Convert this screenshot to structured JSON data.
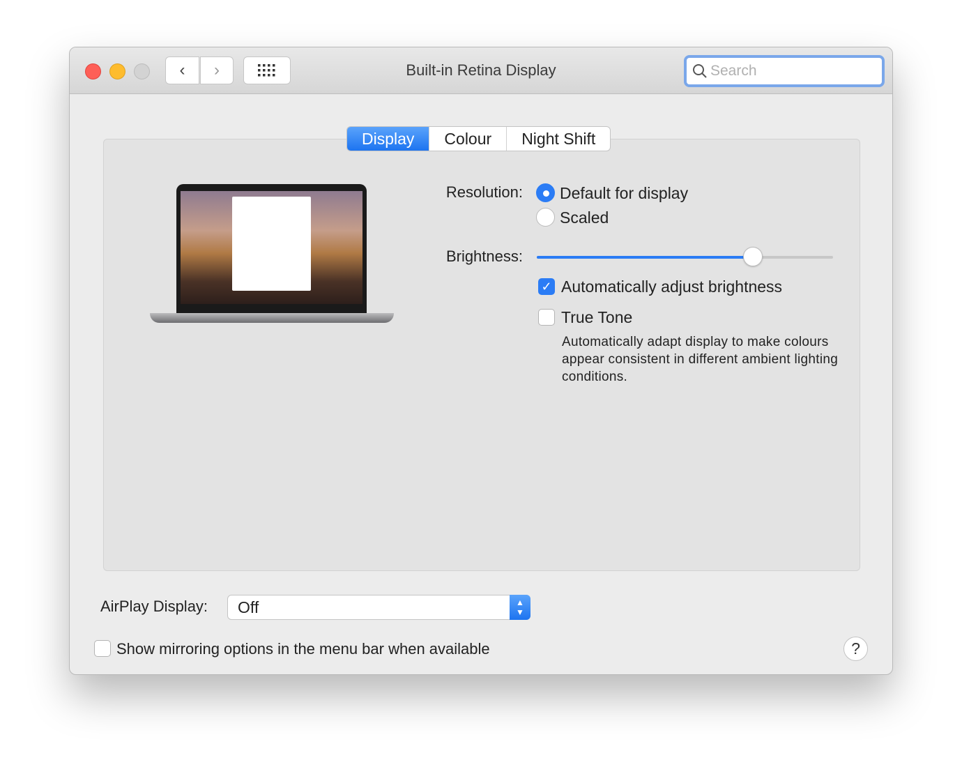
{
  "window": {
    "title": "Built-in Retina Display"
  },
  "toolbar": {
    "back_icon": "chevron-left",
    "forward_icon": "chevron-right",
    "grid_icon": "grid-icon"
  },
  "search": {
    "placeholder": "Search",
    "value": ""
  },
  "tabs": [
    {
      "label": "Display",
      "active": true
    },
    {
      "label": "Colour",
      "active": false
    },
    {
      "label": "Night Shift",
      "active": false
    }
  ],
  "resolution": {
    "label": "Resolution:",
    "options": [
      {
        "label": "Default for display",
        "selected": true
      },
      {
        "label": "Scaled",
        "selected": false
      }
    ]
  },
  "brightness": {
    "label": "Brightness:",
    "value_percent": 73
  },
  "auto_brightness": {
    "label": "Automatically adjust brightness",
    "checked": true
  },
  "true_tone": {
    "label": "True Tone",
    "checked": false,
    "description": "Automatically adapt display to make colours appear consistent in different ambient lighting conditions."
  },
  "airplay": {
    "label": "AirPlay Display:",
    "value": "Off"
  },
  "mirroring": {
    "label": "Show mirroring options in the menu bar when available",
    "checked": false
  },
  "help": {
    "label": "?"
  },
  "colors": {
    "accent": "#2b7cf5",
    "close": "#fe5f57",
    "minimize": "#febc2e"
  }
}
